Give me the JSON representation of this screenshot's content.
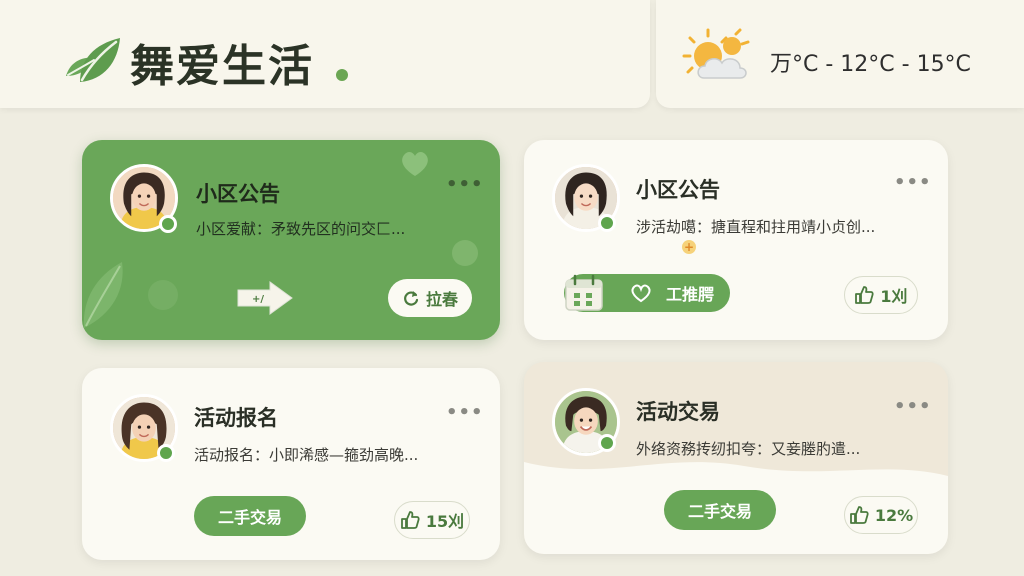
{
  "header": {
    "app_title": "舞爱生活",
    "weather_text": "万°C - 12°C - 15°C",
    "brand_color": "#6aa759"
  },
  "cards": [
    {
      "title": "小区公告",
      "desc": "小区爱献：矛致先区的问交匚...",
      "action_label": "拉春",
      "style": "green"
    },
    {
      "title": "小区公告",
      "desc": "涉活劫噶：搪直程和拄用靖小贞创...",
      "button_label": "工推腭",
      "like_count": "1刈"
    },
    {
      "title": "活动报名",
      "desc": "活动报名：小即浠感—箍劲高晚...",
      "button_label": "二手交易",
      "like_count": "15刈"
    },
    {
      "title": "活动交易",
      "desc": "外络资務抟纫扣夸：又妾塍肑遣...",
      "button_label": "二手交易",
      "like_count": "12%"
    }
  ],
  "icons": {
    "brand": "leaf-icon",
    "weather": "partly-cloudy-icon",
    "more": "more-dots-icon",
    "like": "thumbs-up-icon",
    "heart": "heart-icon",
    "calendar": "calendar-icon",
    "arrow": "arrow-right-icon",
    "refresh": "refresh-icon"
  }
}
